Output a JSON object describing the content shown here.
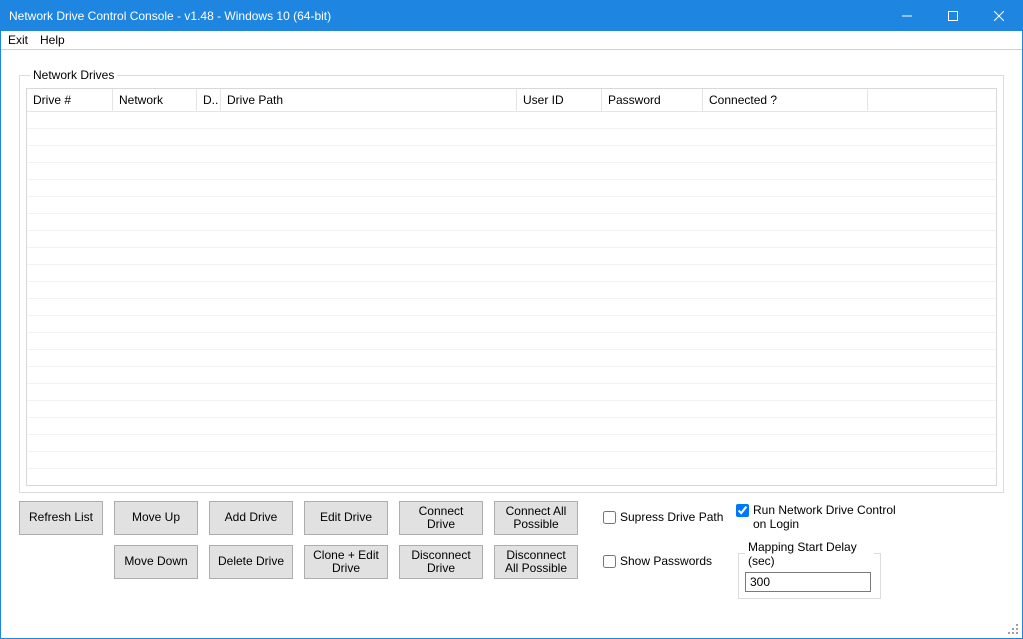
{
  "window": {
    "title": "Network Drive Control Console - v1.48 - Windows 10  (64-bit)"
  },
  "menu": {
    "exit": "Exit",
    "help": "Help"
  },
  "groupbox": {
    "legend": "Network Drives"
  },
  "columns": {
    "drive_no": "Drive #",
    "network": "Network",
    "d": "D..",
    "drive_path": "Drive Path",
    "user_id": "User ID",
    "password": "Password",
    "connected": "Connected ?"
  },
  "buttons": {
    "refresh": "Refresh List",
    "move_up": "Move Up",
    "move_down": "Move Down",
    "add_drive": "Add Drive",
    "delete_drive": "Delete Drive",
    "edit_drive": "Edit Drive",
    "clone_edit": "Clone + Edit Drive",
    "connect": "Connect Drive",
    "disconnect": "Disconnect Drive",
    "connect_all": "Connect All Possible",
    "disconnect_all": "Disconnect All Possible"
  },
  "checkboxes": {
    "supress_path": "Supress Drive Path",
    "show_passwords": "Show Passwords",
    "run_on_login": "Run Network Drive Control on Login"
  },
  "delay": {
    "legend": "Mapping Start Delay (sec)",
    "value": "300"
  }
}
